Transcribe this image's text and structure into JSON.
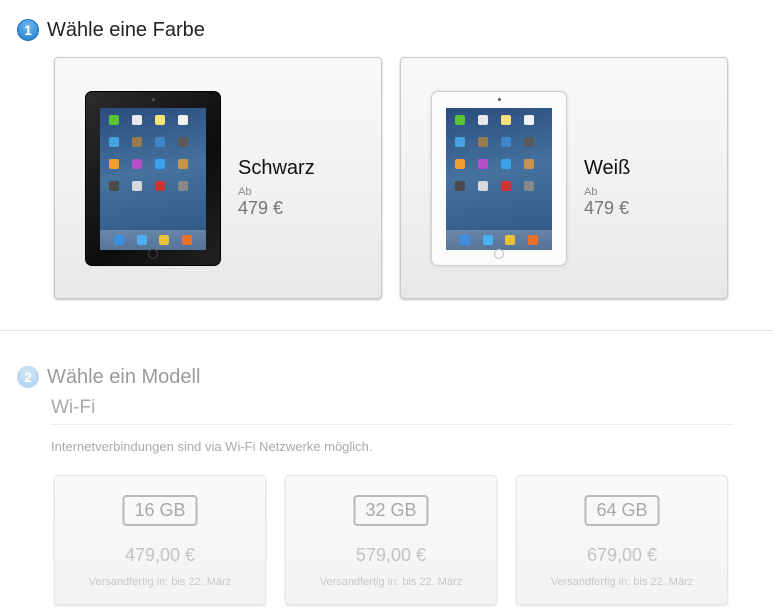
{
  "step1": {
    "number": "1",
    "title": "Wähle eine Farbe"
  },
  "colors": [
    {
      "name": "Schwarz",
      "from_label": "Ab",
      "price": "479 €"
    },
    {
      "name": "Weiß",
      "from_label": "Ab",
      "price": "479 €"
    }
  ],
  "step2": {
    "number": "2",
    "title": "Wähle ein Modell"
  },
  "wifi": {
    "title": "Wi-Fi",
    "description": "Internetverbindungen sind via Wi-Fi Netzwerke möglich."
  },
  "capacities": [
    {
      "size": "16 GB",
      "price": "479,00 €",
      "shipping": "Versandfertig in: bis 22. März"
    },
    {
      "size": "32 GB",
      "price": "579,00 €",
      "shipping": "Versandfertig in: bis 22. März"
    },
    {
      "size": "64 GB",
      "price": "679,00 €",
      "shipping": "Versandfertig in: bis 22. März"
    }
  ],
  "app_icon_colors": [
    "#5bc236",
    "#e8e8e8",
    "#f5e27a",
    "#f2f2f2",
    "#47a2e0",
    "#9a7b4f",
    "#3f86c9",
    "#5a5a5a",
    "#f0a030",
    "#b64fc8",
    "#3ea0e8",
    "#c5944a",
    "#4a4a4a",
    "#d9d9d9",
    "#cc3333",
    "#888888"
  ],
  "dock_icon_colors": [
    "#3b8fe0",
    "#4fb0f0",
    "#e9c23a",
    "#e8702a"
  ]
}
